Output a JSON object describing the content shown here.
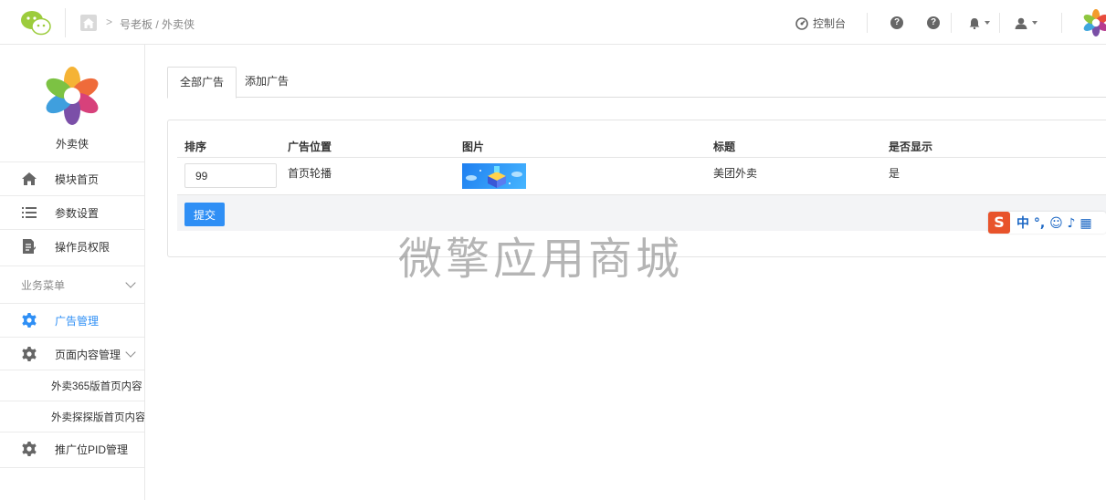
{
  "topbar": {
    "breadcrumb": "号老板 / 外卖侠",
    "breadcrumb_sep": ">",
    "control_label": "控制台"
  },
  "sidebar": {
    "brand_name": "外卖侠",
    "items": [
      {
        "label": "模块首页"
      },
      {
        "label": "参数设置"
      },
      {
        "label": "操作员权限"
      }
    ],
    "section_label": "业务菜单",
    "menu": [
      {
        "label": "广告管理",
        "active": true
      },
      {
        "label": "页面内容管理"
      }
    ],
    "submenu": [
      {
        "label": "外卖365版首页内容"
      },
      {
        "label": "外卖探探版首页内容"
      }
    ],
    "last_item": {
      "label": "推广位PID管理"
    }
  },
  "tabs": [
    {
      "label": "全部广告",
      "active": true
    },
    {
      "label": "添加广告"
    }
  ],
  "table": {
    "headers": [
      "排序",
      "广告位置",
      "图片",
      "标题",
      "是否显示"
    ],
    "rows": [
      {
        "sort": "99",
        "position": "首页轮播",
        "title": "美团外卖",
        "show": "是"
      }
    ]
  },
  "submit_label": "提交",
  "watermark": "微擎应用商城",
  "ime": {
    "logo": "S",
    "text": "中 °, ☺ ♪ ▦"
  },
  "colors": {
    "accent": "#2f8ff5",
    "ime": "#e8532b"
  }
}
